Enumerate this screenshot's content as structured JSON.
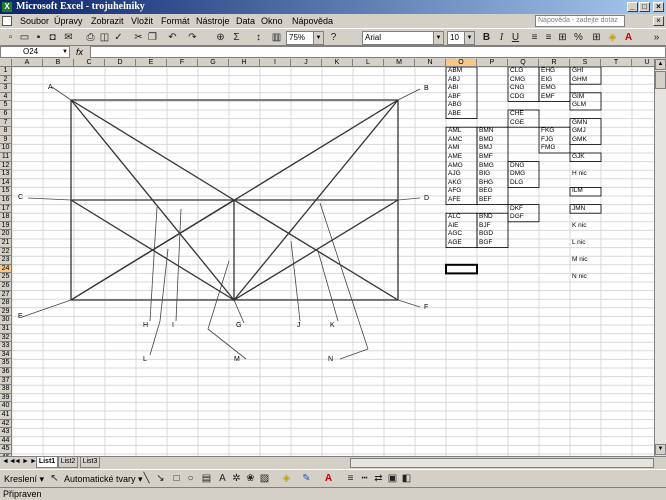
{
  "window": {
    "title": "Microsoft Excel - trojuhelniky"
  },
  "menus": [
    "Soubor",
    "Úpravy",
    "Zobrazit",
    "Vložit",
    "Formát",
    "Nástroje",
    "Data",
    "Okno",
    "Nápověda"
  ],
  "help_box": {
    "placeholder": "Nápověda - zadejte dotaz"
  },
  "toolbar": {
    "zoom": "75%",
    "font_name": "Arial",
    "font_size": "10"
  },
  "formula_bar": {
    "name_box": "O24",
    "fx_label": "fx"
  },
  "columns": [
    "A",
    "B",
    "C",
    "D",
    "E",
    "F",
    "G",
    "H",
    "I",
    "J",
    "K",
    "L",
    "M",
    "N",
    "O",
    "P",
    "Q",
    "R",
    "S",
    "T",
    "U"
  ],
  "rows": [
    "1",
    "2",
    "3",
    "4",
    "5",
    "6",
    "7",
    "8",
    "9",
    "10",
    "11",
    "12",
    "13",
    "14",
    "15",
    "16",
    "17",
    "18",
    "19",
    "20",
    "21",
    "22",
    "23",
    "24",
    "25",
    "26",
    "27",
    "28",
    "29",
    "30",
    "31",
    "32",
    "33",
    "34",
    "35",
    "36",
    "37",
    "38",
    "39",
    "40",
    "41",
    "42",
    "43",
    "44",
    "45",
    "46"
  ],
  "selected_cell": "O24",
  "drawing_labels": {
    "A": "A",
    "B": "B",
    "C": "C",
    "D": "D",
    "E": "E",
    "F": "F",
    "G": "G",
    "H": "H",
    "I": "I",
    "J": "J",
    "K": "K",
    "L": "L",
    "M": "M",
    "N": "N"
  },
  "cell_text": {
    "col_O": [
      "ABM",
      "ABJ",
      "ABI",
      "ABF",
      "ABG",
      "ABE",
      "",
      "AML",
      "AMC",
      "AMI",
      "AME",
      "AMG",
      "AJG",
      "AKG",
      "AFG",
      "AFE",
      "",
      "ALC",
      "AIE",
      "AGC",
      "AGE"
    ],
    "col_P": [
      "",
      "",
      "",
      "",
      "",
      "",
      "",
      "BMN",
      "BMD",
      "BMJ",
      "BMF",
      "BMG",
      "BIG",
      "BHG",
      "BEG",
      "BEF",
      "",
      "BND",
      "BJF",
      "BGD",
      "BGF"
    ],
    "col_Q": [
      "CLG",
      "CMG",
      "CNG",
      "CDG",
      "",
      "CHE",
      "CGE",
      "",
      "",
      "",
      "",
      "DNG",
      "DMG",
      "DLG",
      "",
      "",
      "DKF",
      "DGF"
    ],
    "col_R": [
      "EHG",
      "EIG",
      "EMG",
      "EMF",
      "",
      "",
      "",
      "FKG",
      "FJG",
      "FMG"
    ],
    "col_S": [
      "GHI",
      "GHM",
      "",
      "GIM",
      "GLM",
      "",
      "GMN",
      "GMJ",
      "GMK",
      "",
      "GJK",
      "",
      "H nic",
      "",
      "ILM",
      "",
      "JMN",
      "",
      "K nic",
      "",
      "L nic",
      "",
      "M nic",
      "",
      "N nic"
    ]
  },
  "sheets": [
    "List1",
    "List2",
    "List3"
  ],
  "draw_toolbar": {
    "draw_label": "Kreslení",
    "autoshapes_label": "Automatické tvary"
  },
  "status": "Připraven"
}
